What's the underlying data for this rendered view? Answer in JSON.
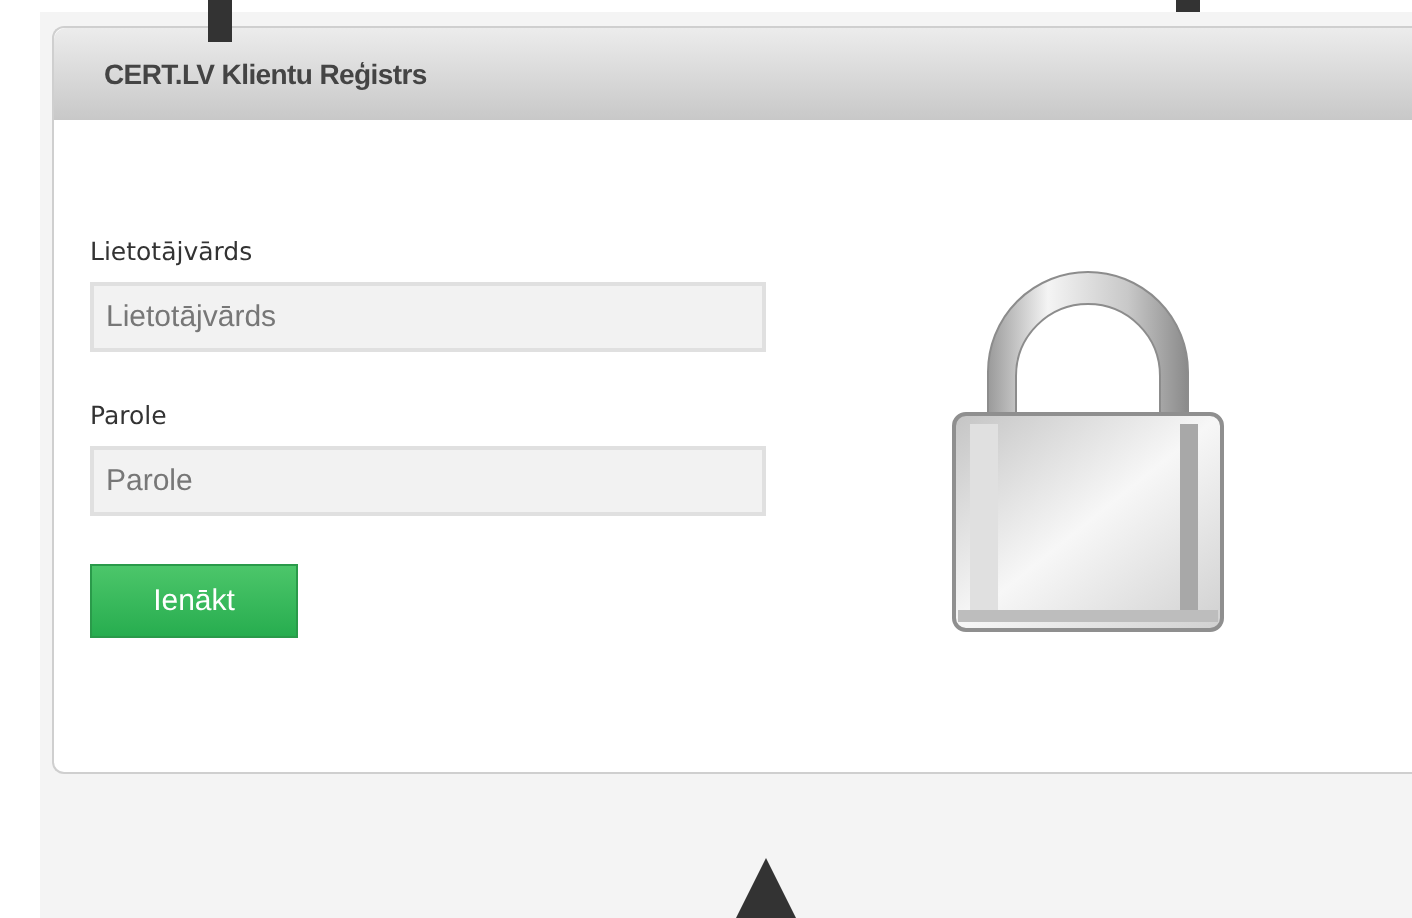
{
  "panel": {
    "title": "CERT.LV Klientu Reģistrs"
  },
  "form": {
    "fields": [
      {
        "label": "Lietotājvārds",
        "placeholder": "Lietotājvārds"
      },
      {
        "label": "Parole",
        "placeholder": "Parole"
      }
    ],
    "submit": "Ienākt"
  }
}
